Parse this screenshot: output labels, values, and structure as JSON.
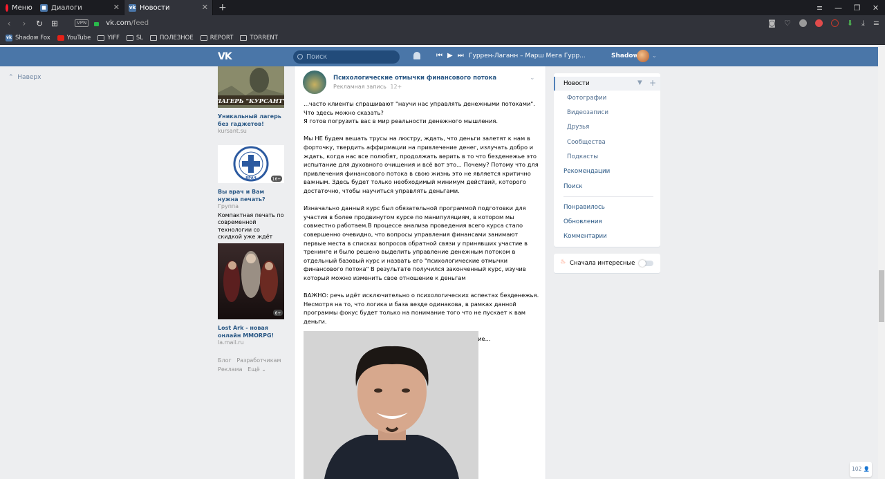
{
  "browser": {
    "menu_label": "Меню",
    "tabs": [
      {
        "label": "Диалоги",
        "icon": "vk-icon"
      },
      {
        "label": "Новости",
        "icon": "vk-icon",
        "active": true
      }
    ],
    "url_host": "vk.com",
    "url_path": "/feed",
    "vpn_label": "VPN",
    "bookmarks": [
      {
        "label": "Shadow Fox",
        "icon": "vk-icon"
      },
      {
        "label": "YouTube",
        "icon": "youtube-icon"
      },
      {
        "label": "YIFF",
        "icon": "folder-icon"
      },
      {
        "label": "SL",
        "icon": "folder-icon"
      },
      {
        "label": "ПОЛЕЗНОЕ",
        "icon": "folder-icon"
      },
      {
        "label": "REPORT",
        "icon": "folder-icon"
      },
      {
        "label": "TORRENT",
        "icon": "folder-icon"
      }
    ]
  },
  "header": {
    "search_placeholder": "Поиск",
    "track": "Гуррен-Лаганн – Марш Мега Гурр...",
    "username": "Shadow"
  },
  "left": {
    "up_label": "Наверх",
    "ads": [
      {
        "image_text": "ЛАГЕРЬ \"КУРСАНТ\"",
        "title": "Уникальный лагерь без гаджетов!",
        "source": "kursant.su",
        "desc": ""
      },
      {
        "image_text": "ВРАЧ",
        "badge": "16+",
        "title": "Вы врач и Вам нужна печать?",
        "source": "Группа",
        "desc": "Компактная печать по современной технологии со скидкой уже ждёт"
      },
      {
        "image_text": "",
        "badge": "6+",
        "title": "Lost Ark - новая онлайн MMORPG!",
        "source": "la.mail.ru",
        "desc": ""
      }
    ],
    "footer_links": [
      "Блог",
      "Разработчикам",
      "Реклама",
      "Ещё"
    ]
  },
  "post": {
    "title": "Психологические отмычки финансового потока",
    "subtitle": "Рекламная запись",
    "age": "12+",
    "paragraphs": [
      "...часто клиенты спрашивают \"научи нас управлять денежными потоками\".\nЧто здесь можно сказать?\nЯ готов погрузить вас в мир реальности денежного мышления.",
      "Мы НЕ будем вешать трусы на люстру, ждать, что деньги залетят к нам в форточку, твердить аффирмации на привлечение денег, излучать добро и ждать, когда нас все полюбят, продолжать верить в то что безденежье это испытание для духовного очищения и всё вот это... Почему? Потому что для привлечения финансового потока в свою жизнь это не является критично важным. Здесь будет только необходимый минимум действий, которого достаточно, чтобы научиться управлять деньгами.",
      "Изначально данный курс был обязательной программой подготовки для участия в более продвинутом курсе по манипуляциям, в котором мы совместно работаем.В процессе анализа проведения всего курса стало совершенно очевидно, что вопросы управления финансами занимают первые места в списках вопросов обратной связи у принявших участие в тренинге и было решено выделить управление денежным потоком в отдельный базовый курс и назвать его \"психологические отмычки финансового потока\" В результате получился законченный курс, изучив который можно изменить свое отношение к деньгам",
      "ВАЖНО: речь идёт исключительно о психологических аспектах безденежья. Несмотря на то, что логика и база везде одинакова, в рамках данной программы фокус будет только на понимание того что не пускает к вам деньги.",
      "И так жду вас в закрытой группе и мы начинаем движение..."
    ]
  },
  "right": {
    "nav": [
      {
        "label": "Новости",
        "selected": true
      },
      {
        "label": "Фотографии",
        "sub": true
      },
      {
        "label": "Видеозаписи",
        "sub": true
      },
      {
        "label": "Друзья",
        "sub": true
      },
      {
        "label": "Сообщества",
        "sub": true
      },
      {
        "label": "Подкасты",
        "sub": true
      },
      {
        "label": "Рекомендации"
      },
      {
        "label": "Поиск"
      },
      {
        "label": "Понравилось"
      },
      {
        "label": "Обновления"
      },
      {
        "label": "Комментарии"
      }
    ],
    "toggle_label": "Сначала интересные"
  },
  "counter": "102"
}
